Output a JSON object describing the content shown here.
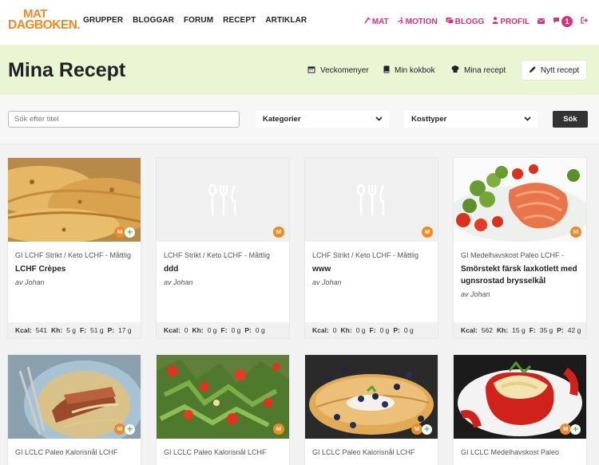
{
  "brand": {
    "line1": "MAT",
    "line2": "DAGBOKEN."
  },
  "nav": {
    "links": [
      "GRUPPER",
      "BLOGGAR",
      "FORUM",
      "RECEPT",
      "ARTIKLAR"
    ],
    "right": [
      {
        "label": "MAT",
        "icon": "fork-icon"
      },
      {
        "label": "MOTION",
        "icon": "runner-icon"
      },
      {
        "label": "BLOGG",
        "icon": "blog-icon"
      },
      {
        "label": "PROFIL",
        "icon": "user-icon"
      }
    ],
    "notification_count": "1",
    "colors": {
      "accent": "#d63384",
      "brand": "#f08a24"
    }
  },
  "header": {
    "title": "Mina Recept",
    "actions": [
      "Veckomenyer",
      "Min kokbok",
      "Mina recept"
    ],
    "new_recipe": "Nytt recept"
  },
  "filters": {
    "search_placeholder": "Sök efter titel",
    "category": "Kategorier",
    "diet": "Kosttyper",
    "search_button": "Sök"
  },
  "recipes": [
    {
      "category": "GI LCHF Strikt / Keto LCHF - Måttlig",
      "title": "LCHF Crèpes",
      "author": "av Johan",
      "kcal": "541",
      "kh": "5 g",
      "f": "51 g",
      "p": "17 g",
      "image": "crepes",
      "plus": true
    },
    {
      "category": "LCHF Strikt / Keto LCHF - Måttlig",
      "title": "ddd",
      "author": "av Johan",
      "kcal": "0",
      "kh": "0 g",
      "f": "0 g",
      "p": "0 g",
      "image": "placeholder",
      "plus": false
    },
    {
      "category": "LCHF Strikt / Keto LCHF - Måttlig",
      "title": "www",
      "author": "av Johan",
      "kcal": "0",
      "kh": "0 g",
      "f": "0 g",
      "p": "0 g",
      "image": "placeholder",
      "plus": false
    },
    {
      "category": "GI Medelhavskost Paleo LCHF -",
      "title": "Smörstekt färsk laxkotlett med ugnsrostad brysselkål",
      "author": "av Johan",
      "kcal": "562",
      "kh": "15 g",
      "f": "35 g",
      "p": "42 g",
      "image": "salmon",
      "plus": false
    },
    {
      "category": "GI LCLC Paleo Kalorisnål LCHF",
      "title": "",
      "author": "",
      "kcal": "",
      "kh": "",
      "f": "",
      "p": "",
      "image": "duck",
      "plus": true
    },
    {
      "category": "GI LCLC Paleo Kalorisnål LCHF",
      "title": "",
      "author": "",
      "kcal": "",
      "kh": "",
      "f": "",
      "p": "",
      "image": "salad",
      "plus": false
    },
    {
      "category": "GI LCLC Paleo Kalorisnål LCHF",
      "title": "",
      "author": "",
      "kcal": "",
      "kh": "",
      "f": "",
      "p": "",
      "image": "blueberry",
      "plus": true
    },
    {
      "category": "GI LCLC Medelhavskost Paleo",
      "title": "",
      "author": "",
      "kcal": "",
      "kh": "",
      "f": "",
      "p": "",
      "image": "pepper",
      "plus": true
    }
  ],
  "labels": {
    "kcal": "Kcal:",
    "kh": "Kh:",
    "f": "F:",
    "p": "P:",
    "badge": "M"
  }
}
